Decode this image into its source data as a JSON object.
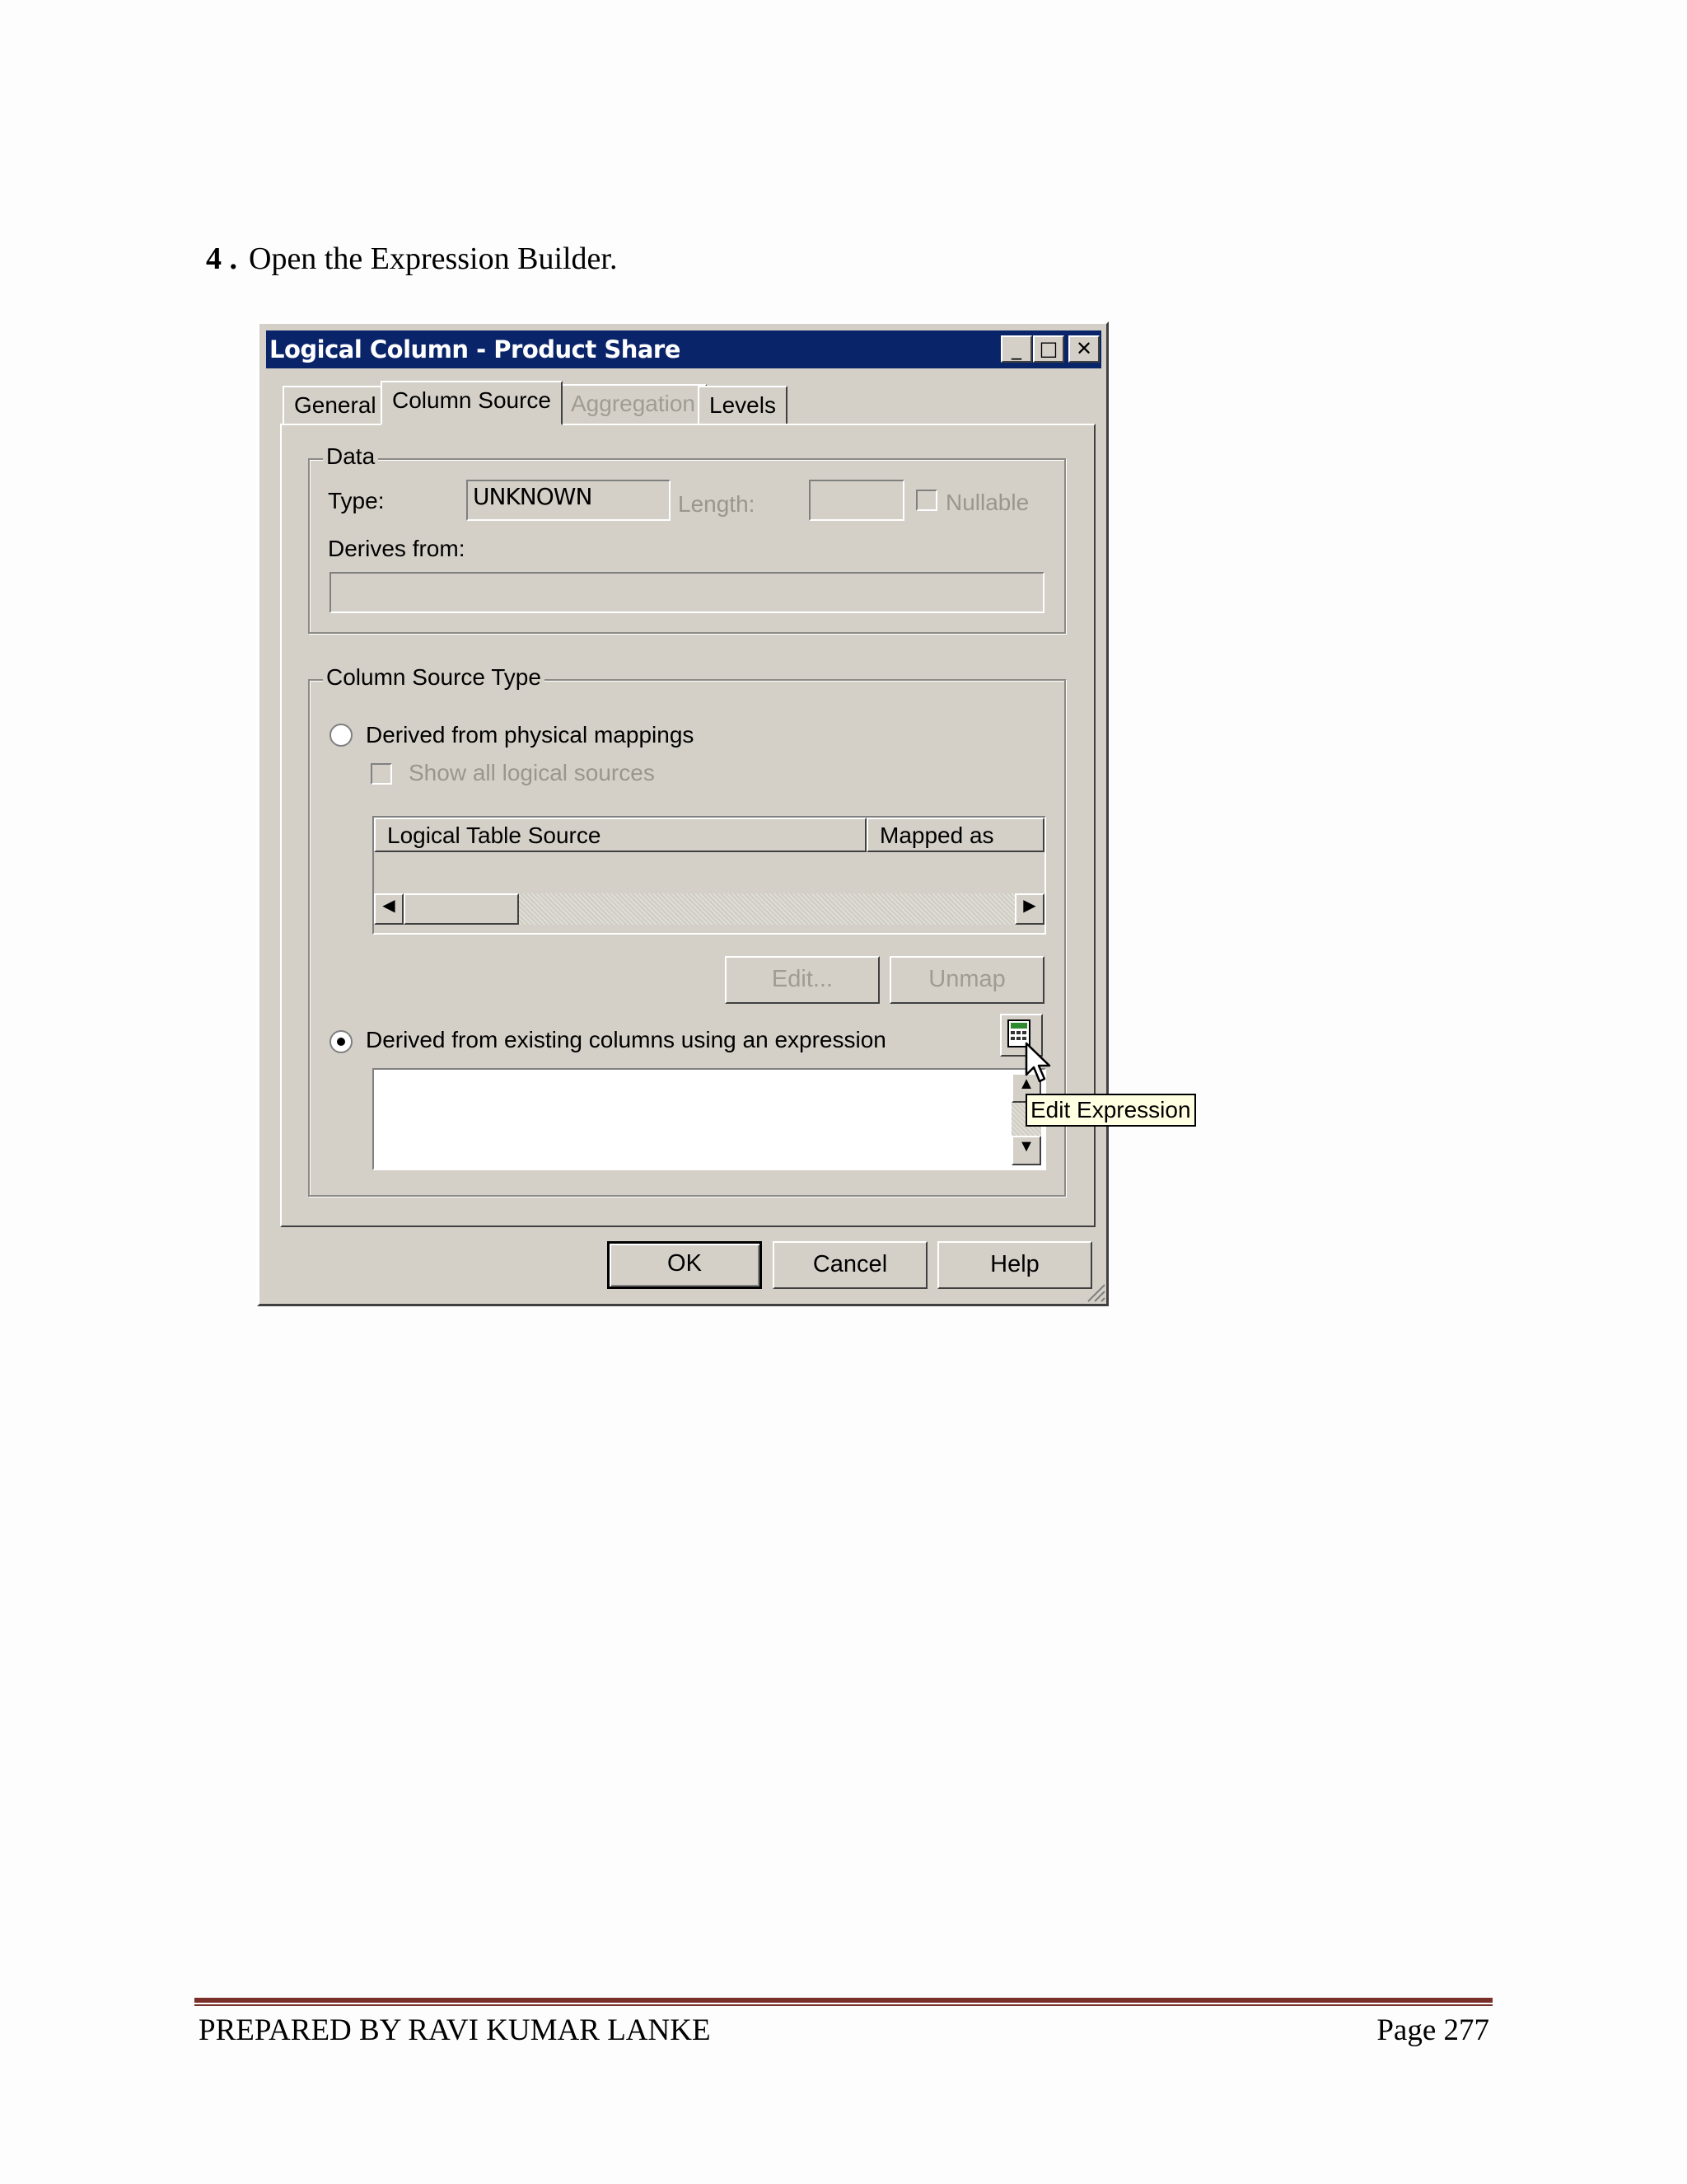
{
  "step": {
    "number": "4 .",
    "text": "Open the Expression Builder."
  },
  "dialog": {
    "title": "Logical Column - Product Share",
    "title_buttons": {
      "minimize": "_",
      "maximize": "□",
      "close": "✕"
    },
    "tabs": [
      {
        "label": "General",
        "state": "normal"
      },
      {
        "label": "Column Source",
        "state": "active"
      },
      {
        "label": "Aggregation",
        "state": "disabled"
      },
      {
        "label": "Levels",
        "state": "normal"
      }
    ],
    "data_group": {
      "legend": "Data",
      "type_label": "Type:",
      "type_value": "UNKNOWN",
      "length_label": "Length:",
      "length_value": "",
      "nullable_label": "Nullable",
      "derives_label": "Derives from:",
      "derives_value": ""
    },
    "source_group": {
      "legend": "Column Source Type",
      "physical_radio": "Derived from physical mappings",
      "show_all_label": "Show all logical sources",
      "table_headers": [
        "Logical Table Source",
        "Mapped as"
      ],
      "edit_button": "Edit...",
      "unmap_button": "Unmap",
      "expression_radio": "Derived from existing columns using an expression",
      "expression_value": "",
      "selected": "expression"
    },
    "tooltip": "Edit Expression",
    "buttons": {
      "ok": "OK",
      "cancel": "Cancel",
      "help": "Help"
    }
  },
  "footer": {
    "left": "PREPARED BY RAVI KUMAR LANKE",
    "right": "Page 277"
  },
  "colors": {
    "titlebar": "#0a246a",
    "face": "#d4d0c8",
    "footer_rule": "#7a2f2a",
    "tooltip_bg": "#ffffe1"
  }
}
